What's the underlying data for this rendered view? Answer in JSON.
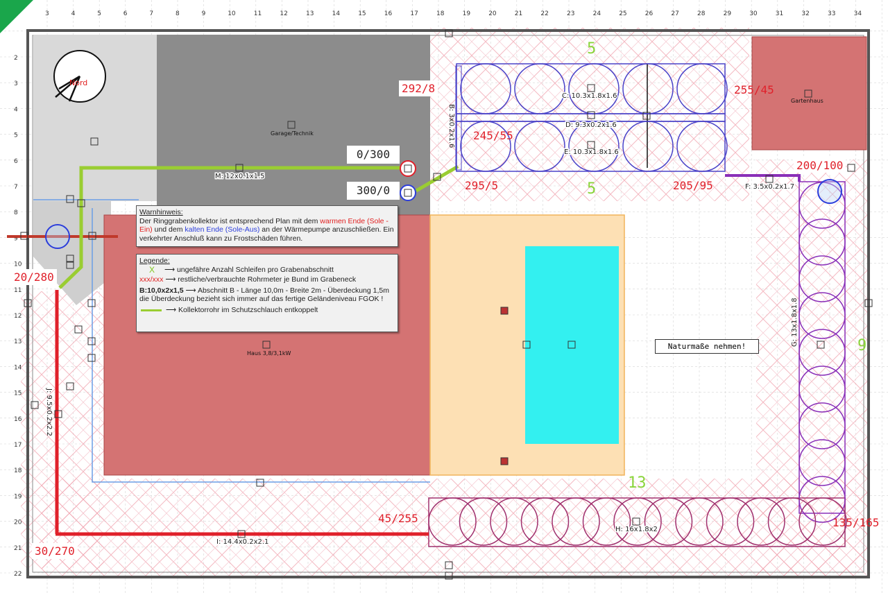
{
  "grid": {
    "top_ruler": [
      "3",
      "4",
      "5",
      "6",
      "7",
      "8",
      "9",
      "10",
      "11",
      "12",
      "13",
      "14",
      "15",
      "16",
      "17",
      "18",
      "19",
      "20",
      "21",
      "22",
      "23",
      "24",
      "25",
      "26",
      "27",
      "28",
      "29",
      "30",
      "31",
      "32",
      "33",
      "34"
    ],
    "left_ruler": [
      "2",
      "3",
      "4",
      "5",
      "6",
      "7",
      "8",
      "9",
      "10",
      "11",
      "12",
      "13",
      "14",
      "15",
      "16",
      "17",
      "18",
      "19",
      "20",
      "21",
      "22"
    ]
  },
  "compass": {
    "label": "Nord"
  },
  "areas": {
    "garage": "Garage/Technik",
    "house": "Haus 3,8/3,1kW",
    "garden_house": "Gartenhaus"
  },
  "sections": {
    "M": "M: 12x0.1x1.5",
    "C": "C: 10.3x1.8x1.6",
    "D": "D: 9.3x0.2x1.6",
    "E": "E: 10.3x1.8x1.6",
    "B": "B: 3x0.2x1.6",
    "F": "F: 3.5x0.2x1.7",
    "G": "G: 13x1.8x1.8",
    "H": "H: 16x1.8x2",
    "I": "I: 14.4x0.2x2.1",
    "J": "J: 9.5x0.2x2.2"
  },
  "loop_counts": {
    "top": "5",
    "middle": "5",
    "right": "9",
    "bottom": "13"
  },
  "meters": {
    "m292": "292/8",
    "m245": "245/55",
    "m295": "295/5",
    "m255": "255/45",
    "m205": "205/95",
    "m200": "200/100",
    "m20": "20/280",
    "m30": "30/270",
    "m45": "45/255",
    "m135": "135/165"
  },
  "ports": {
    "warm": "0/300",
    "cold": "300/0"
  },
  "warning": {
    "title": "Warnhinweis:",
    "t1": "Der Ringgrabenkollektor ist entsprechend Plan mit dem ",
    "warm": "warmen Ende (Sole -Ein)",
    "t2": " und dem ",
    "cold": "kalten Ende (Sole-Aus)",
    "t3": " an der Wärmepumpe anzuschließen. Ein verkehrter Anschluß kann zu Frostschäden führen."
  },
  "legend": {
    "title": "Legende:",
    "x_symbol": "X",
    "x_text": "⟶  ungefähre Anzahl Schleifen pro Grabenabschnitt",
    "xxx_symbol": "xxx/xxx",
    "xxx_text": " ⟶  restliche/verbrauchte Rohrmeter je Bund im Grabeneck",
    "b_bold": "B:10,0x2x1,5",
    "b_text": " ⟶ Abschnitt B - Länge 10,0m - Breite 2m - Überdeckung 1,5m die Überdeckung bezieht sich immer auf das fertige Geländeniveau FGOK !",
    "green_text": "⟶ Kollektorrohr im Schutzschlauch entkoppelt"
  },
  "note": "Naturmaße nehmen!",
  "colors": {
    "house": "#d47373",
    "garage": "#8c8c8c",
    "pool": "#33f0f0",
    "terrace": "#fde0b4",
    "loop_blue": "#4a42c8",
    "loop_purple": "#8a2fb8",
    "loop_magenta": "#a0306e",
    "collector_green": "#9acd32"
  }
}
